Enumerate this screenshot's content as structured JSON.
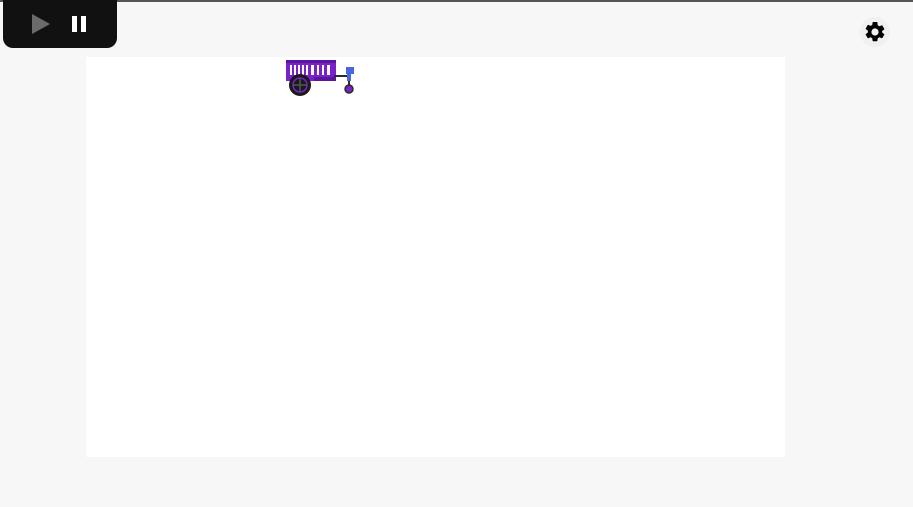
{
  "controls": {
    "play_icon": "play-icon",
    "pause_icon": "pause-icon",
    "settings_icon": "gear-icon"
  },
  "stage": {
    "sprite": "cart-sprite"
  },
  "colors": {
    "toolbar_bg": "#111111",
    "stage_bg": "#ffffff",
    "page_bg": "#f7f7f7",
    "sprite_purple": "#7a22c9",
    "sprite_blue": "#4a67e0"
  }
}
